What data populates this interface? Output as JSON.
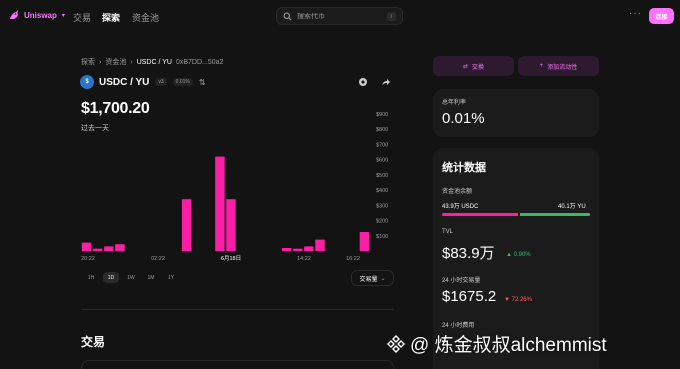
{
  "nav": {
    "brand": "Uniswap",
    "links": [
      "交易",
      "探索",
      "资金池"
    ],
    "active_index": 1,
    "search_placeholder": "搜索代币",
    "search_shortcut": "/",
    "more": "···",
    "connect_label": "连接"
  },
  "breadcrumb": {
    "items": [
      "探索",
      "资金池",
      "USDC / YU"
    ],
    "address": "0xB7DD...50a2"
  },
  "pair": {
    "name": "USDC / YU",
    "version": "v3",
    "fee": "0.01%",
    "token_icon": "usdc-icon",
    "price": "$1,700.20",
    "period": "过去一天"
  },
  "chart_data": {
    "type": "bar",
    "metric": "交易量",
    "x_tick_labels": [
      "20:22",
      "02:22",
      "6月18日",
      "14:22",
      "16:22"
    ],
    "y_tick_labels": [
      "$100",
      "$200",
      "$300",
      "$400",
      "$500",
      "$600",
      "$700",
      "$800",
      "$900"
    ],
    "ylim": [
      0,
      900
    ],
    "values": [
      55,
      15,
      30,
      45,
      0,
      0,
      0,
      0,
      0,
      340,
      0,
      0,
      620,
      340,
      0,
      0,
      0,
      0,
      20,
      15,
      30,
      75,
      0,
      0,
      0,
      125
    ],
    "color": "#fc1fa5"
  },
  "range": {
    "options": [
      "1H",
      "1D",
      "1W",
      "1M",
      "1Y"
    ],
    "selected_index": 1
  },
  "metric_select": "交易量",
  "transactions_heading": "交易",
  "actions": {
    "swap_label": "交换",
    "add_liquidity_label": "添加流动性"
  },
  "apr": {
    "label": "总年利率",
    "value": "0.01%"
  },
  "stats": {
    "title": "统计数据",
    "balance_label": "资金池余额",
    "balance_left": "43.9万 USDC",
    "balance_right": "40.1万 YU",
    "left_share": 0.52,
    "tvl_label": "TVL",
    "tvl_value": "$83.9万",
    "tvl_change": "0.90%",
    "volume_label": "24 小时交易量",
    "volume_value": "$1675.2",
    "volume_change": "72.26%",
    "fees_label": "24 小时费用"
  },
  "colors": {
    "accent": "#fc72ff",
    "bar": "#fc1fa5",
    "green": "#40b66b",
    "red": "#ff5f52"
  },
  "watermark": "@ 炼金叔叔alchemmist"
}
